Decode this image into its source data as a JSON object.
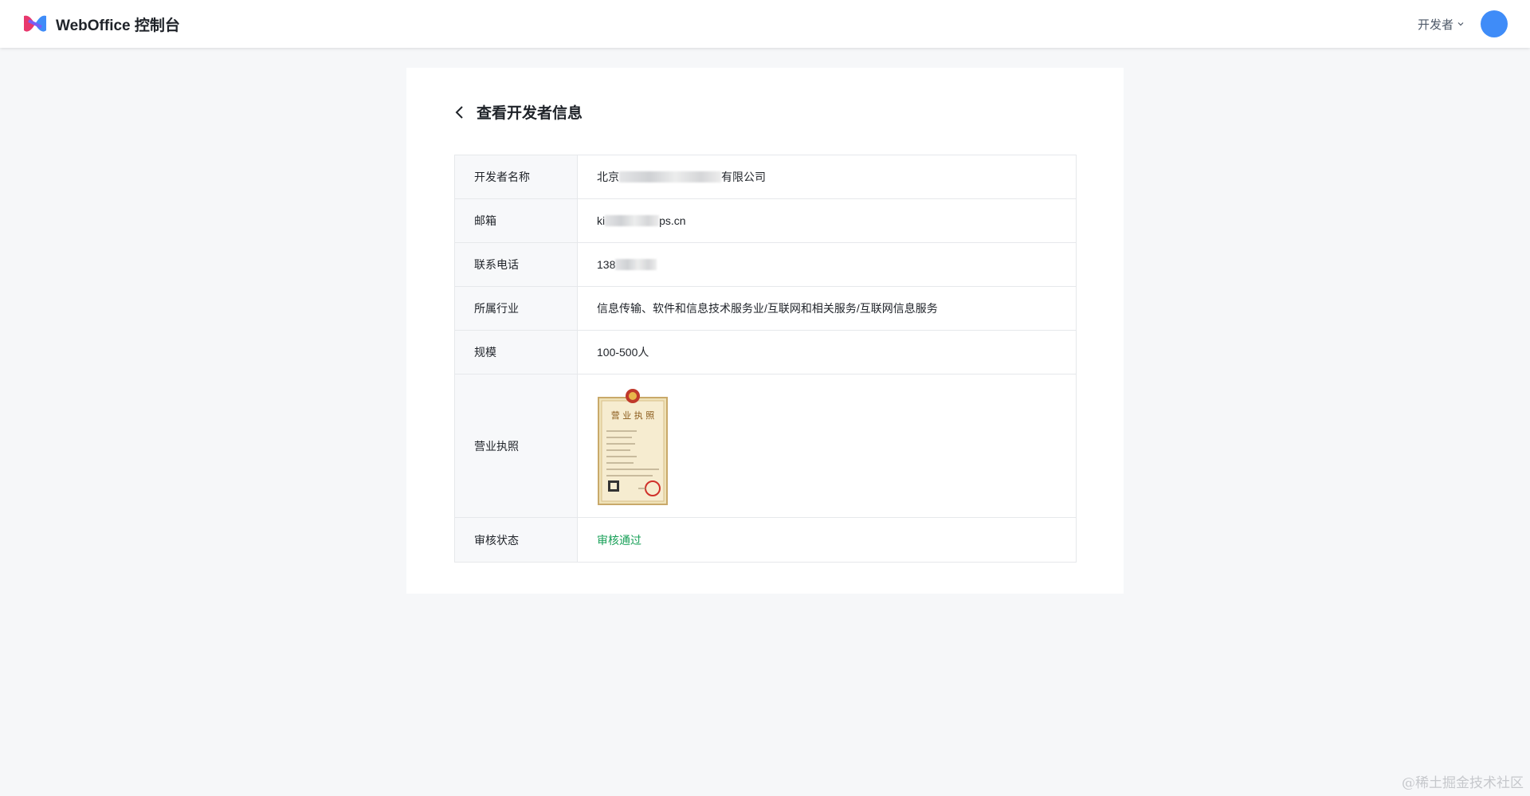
{
  "app": {
    "title": "WebOffice 控制台"
  },
  "header": {
    "role_label": "开发者",
    "icons": {
      "logo": "weboffice-logo",
      "role_chevron": "chevron-down-icon",
      "avatar": "user-avatar"
    },
    "avatar_color": "#3f8cf8"
  },
  "page": {
    "title": "查看开发者信息",
    "back_icon": "chevron-left-icon"
  },
  "rows": [
    {
      "label": "开发者名称",
      "value_prefix": "北京",
      "value_suffix": "有限公司"
    },
    {
      "label": "邮箱",
      "value_prefix": "ki",
      "value_suffix": "ps.cn"
    },
    {
      "label": "联系电话",
      "value_prefix": "138",
      "value_suffix": ""
    },
    {
      "label": "所属行业",
      "value": "信息传输、软件和信息技术服务业/互联网和相关服务/互联网信息服务"
    },
    {
      "label": "规模",
      "value": "100-500人"
    },
    {
      "label": "营业执照",
      "value_image": "business-license-image"
    },
    {
      "label": "审核状态",
      "value": "审核通过",
      "status_color": "#18a058"
    }
  ],
  "license": {
    "heading": "营 业 执 照"
  },
  "watermark": "@稀土掘金技术社区"
}
